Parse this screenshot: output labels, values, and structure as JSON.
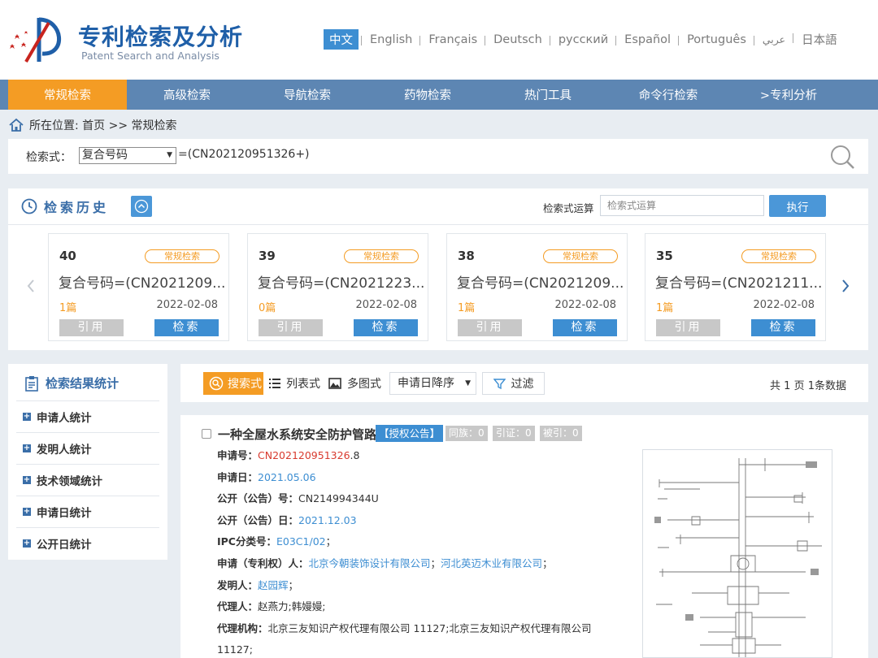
{
  "brand": {
    "title_cn": "专利检索及分析",
    "title_en": "Patent Search and Analysis"
  },
  "languages": [
    "中文",
    "English",
    "Français",
    "Deutsch",
    "русский",
    "Español",
    "Português",
    "عربي",
    "日本語"
  ],
  "nav": [
    "常规检索",
    "高级检索",
    "导航检索",
    "药物检索",
    "热门工具",
    "命令行检索",
    ">专利分析"
  ],
  "breadcrumb": "所在位置: 首页 >> 常规检索",
  "search": {
    "label": "检索式：",
    "field": "复合号码",
    "query": "=(CN202120951326+)"
  },
  "history": {
    "title": "检索历史",
    "op_label": "检索式运算",
    "op_placeholder": "检索式运算",
    "exec_label": "执行",
    "cards": [
      {
        "num": "40",
        "tag": "常规检索",
        "query": "复合号码=(CN2021209...",
        "count": "1篇",
        "date": "2022-02-08",
        "cite": "引用",
        "go": "检索"
      },
      {
        "num": "39",
        "tag": "常规检索",
        "query": "复合号码=(CN2021223...",
        "count": "0篇",
        "date": "2022-02-08",
        "cite": "引用",
        "go": "检索"
      },
      {
        "num": "38",
        "tag": "常规检索",
        "query": "复合号码=(CN2021209...",
        "count": "1篇",
        "date": "2022-02-08",
        "cite": "引用",
        "go": "检索"
      },
      {
        "num": "35",
        "tag": "常规检索",
        "query": "复合号码=(CN2021211...",
        "count": "1篇",
        "date": "2022-02-08",
        "cite": "引用",
        "go": "检索"
      }
    ]
  },
  "stats": {
    "title": "检索结果统计",
    "items": [
      "申请人统计",
      "发明人统计",
      "技术领域统计",
      "申请日统计",
      "公开日统计"
    ]
  },
  "toolbar": {
    "view_search": "搜索式",
    "view_list": "列表式",
    "view_multi": "多图式",
    "sort": "申请日降序",
    "filter": "过滤",
    "page_info": "共 1 页 1条数据"
  },
  "result": {
    "title": "一种全屋水系统安全防护管路",
    "badge": "【授权公告】",
    "tongzu": "同族：0",
    "yinzheng": "引证：0",
    "beiyin": "被引：0",
    "fields": {
      "app_no_label": "申请号：",
      "app_no_red": "CN202120951326",
      "app_no_suffix": ".8",
      "app_date_label": "申请日：",
      "app_date": "2021.05.06",
      "pub_no_label": "公开（公告）号：",
      "pub_no": "CN214994344U",
      "pub_date_label": "公开（公告）日：",
      "pub_date": "2021.12.03",
      "ipc_label": "IPC分类号：",
      "ipc": "E03C1/02",
      "ipc_suffix": "；",
      "applicant_label": "申请（专利权）人：",
      "applicant_1": "北京今朝装饰设计有限公司",
      "applicant_sep": "；",
      "applicant_2": "河北英迈木业有限公司",
      "applicant_suffix": "；",
      "inventor_label": "发明人：",
      "inventor": "赵园辉",
      "inventor_suffix": "；",
      "agent_label": "代理人：",
      "agent": "赵燕力;韩嫚嫚;",
      "agency_label": "代理机构：",
      "agency": "北京三友知识产权代理有限公司 11127;北京三友知识产权代理有限公司",
      "agency_cont": "11127;"
    }
  }
}
